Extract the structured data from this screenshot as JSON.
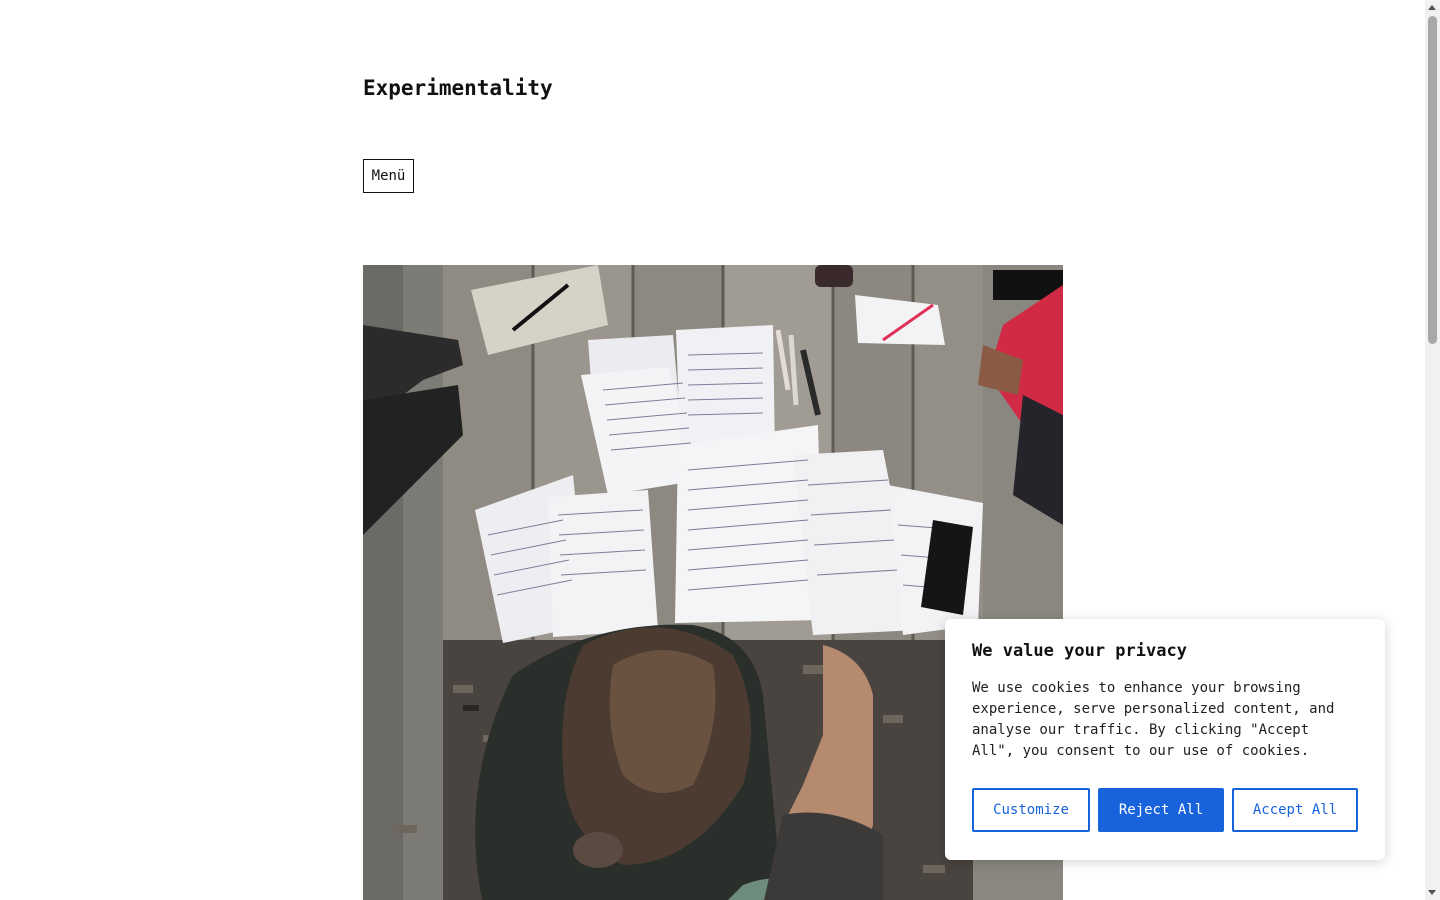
{
  "site": {
    "title": "Experimentality"
  },
  "nav": {
    "menu_label": "Menü"
  },
  "hero_image": {
    "description_icon": "photo-people-at-table-with-handwritten-papers"
  },
  "cookie_banner": {
    "title": "We value your privacy",
    "text": "We use cookies to enhance your browsing experience, serve personalized content, and analyse our traffic. By clicking \"Accept All\", you consent to our use of cookies.",
    "customize_label": "Customize",
    "reject_label": "Reject All",
    "accept_label": "Accept All",
    "accent_color": "#1863dc"
  }
}
